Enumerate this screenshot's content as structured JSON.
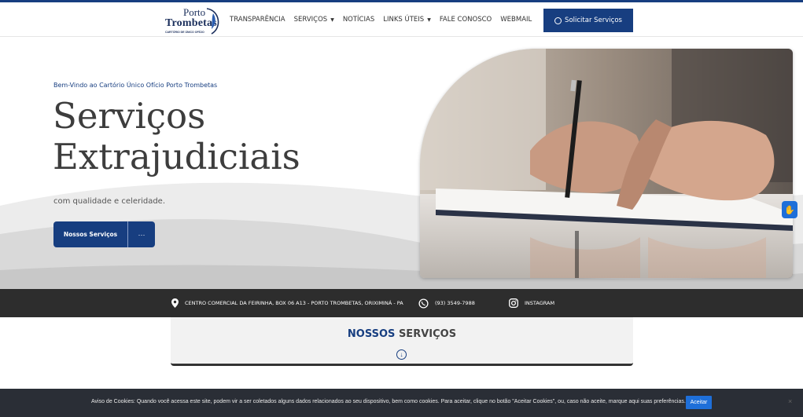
{
  "header": {
    "logo_line1": "Porto",
    "logo_line2": "Trombetas",
    "logo_tagline": "CARTÓRIO DE ÚNICO OFÍCIO",
    "nav": [
      {
        "label": "TRANSPARÊNCIA",
        "dropdown": false
      },
      {
        "label": "SERVIÇOS",
        "dropdown": true
      },
      {
        "label": "NOTÍCIAS",
        "dropdown": false
      },
      {
        "label": "LINKS ÚTEIS",
        "dropdown": true
      },
      {
        "label": "FALE CONOSCO",
        "dropdown": false
      },
      {
        "label": "WEBMAIL",
        "dropdown": false
      }
    ],
    "cta_label": "Solicitar Serviços",
    "cta_icon": "whatsapp-icon"
  },
  "hero": {
    "kicker": "Bem-Vindo ao Cartório Único Ofício Porto Trombetas",
    "headline_line1": "Serviços",
    "headline_line2": "Extrajudiciais",
    "subline": "com qualidade e celeridade.",
    "primary_button": "Nossos Serviços",
    "more_button": "···"
  },
  "infobar": {
    "address": "CENTRO COMERCIAL DA FEIRINHA, BOX 06 A13 - PORTO TROMBETAS, ORIXIMINÁ - PA",
    "phone": "(93) 3549-7988",
    "instagram": "INSTAGRAM"
  },
  "services": {
    "title_highlight": "NOSSOS",
    "title_rest": " SERVIÇOS"
  },
  "cookie": {
    "text": "Aviso de Cookies: Quando você acessa este site, podem vir a ser coletados alguns dados relacionados ao seu dispositivo, bem como cookies. Para aceitar, clique no botão \"Aceitar Cookies\", ou, caso não aceite, marque aqui suas preferências.",
    "accept_label": "Aceitar",
    "close_label": "×"
  },
  "colors": {
    "brand": "#173e80",
    "infobar_bg": "#2d2d2d",
    "cookie_bg": "#2a2e36",
    "accent_blue": "#1e6fd9"
  }
}
